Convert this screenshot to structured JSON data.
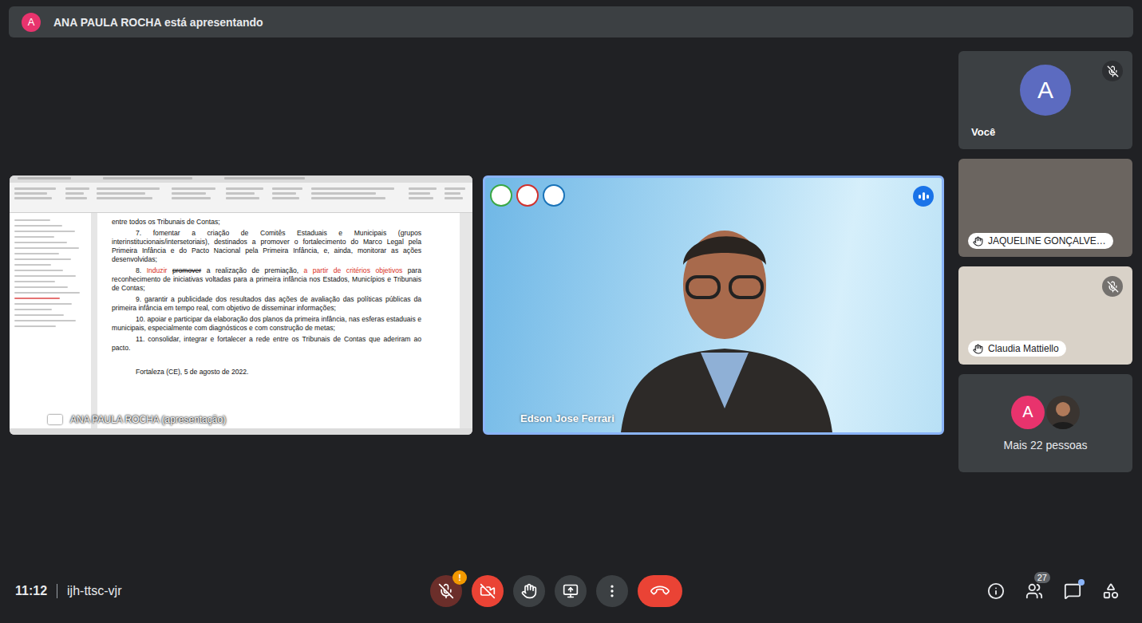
{
  "banner": {
    "avatar": "A",
    "text": "ANA PAULA ROCHA está apresentando"
  },
  "presentation": {
    "label": "ANA PAULA ROCHA (apresentação)",
    "document": {
      "paragraphs": [
        {
          "indent": false,
          "segments": [
            {
              "text": "entre todos os Tribunais de Contas;",
              "style": "normal"
            }
          ]
        },
        {
          "indent": true,
          "segments": [
            {
              "text": "7. fomentar a criação de Comitês Estaduais e Municipais (grupos interinstitucionais/intersetoriais), destinados a promover o fortalecimento do Marco Legal pela Primeira Infância e do Pacto Nacional pela Primeira Infância, e, ainda, monitorar as ações desenvolvidas;",
              "style": "normal"
            }
          ]
        },
        {
          "indent": true,
          "segments": [
            {
              "text": "8. ",
              "style": "normal"
            },
            {
              "text": "Induzir",
              "style": "inserted"
            },
            {
              "text": " ",
              "style": "normal"
            },
            {
              "text": "promover",
              "style": "deleted"
            },
            {
              "text": " a realização de premiação, ",
              "style": "normal"
            },
            {
              "text": "a partir de critérios objetivos",
              "style": "inserted"
            },
            {
              "text": " para reconhecimento de iniciativas voltadas para a primeira infância nos Estados, Municípios e Tribunais de Contas;",
              "style": "normal"
            }
          ]
        },
        {
          "indent": true,
          "segments": [
            {
              "text": "9. garantir a publicidade dos resultados das ações de avaliação das políticas públicas da primeira infância em tempo real, com objetivo de disseminar informações;",
              "style": "normal"
            }
          ]
        },
        {
          "indent": true,
          "segments": [
            {
              "text": "10. apoiar e participar da elaboração dos planos da primeira infância, nas esferas estaduais e municipais, especialmente com diagnósticos e com construção de metas;",
              "style": "normal"
            }
          ]
        },
        {
          "indent": true,
          "segments": [
            {
              "text": "11. consolidar, integrar e fortalecer a rede entre os Tribunais de Contas que aderiram ao pacto.",
              "style": "normal"
            }
          ]
        }
      ],
      "date": "Fortaleza (CE), 5 de agosto de 2022."
    }
  },
  "speaker": {
    "name": "Edson Jose Ferrari",
    "speaking": true
  },
  "participants": [
    {
      "kind": "avatar",
      "name": "Você",
      "avatar": "A",
      "muted": true,
      "hand": false,
      "color": "#5c6bc0"
    },
    {
      "kind": "video",
      "name": "JAQUELINE GONÇALVE…",
      "muted": false,
      "hand": true,
      "color": "#6b6560"
    },
    {
      "kind": "video",
      "name": "Claudia Mattiello",
      "muted": true,
      "hand": true,
      "color": "#d9d2c8"
    }
  ],
  "more": {
    "label": "Mais 22 pessoas",
    "avatars": [
      {
        "kind": "letter",
        "text": "A",
        "color": "#e8336d"
      },
      {
        "kind": "photo",
        "color": "#3a3430"
      }
    ]
  },
  "footer": {
    "time": "11:12",
    "code": "ijh-ttsc-vjr"
  },
  "controls": [
    {
      "kind": "microphone",
      "on": false,
      "alert": "!"
    },
    {
      "kind": "camera",
      "on": false
    },
    {
      "kind": "hand"
    },
    {
      "kind": "present"
    },
    {
      "kind": "more"
    },
    {
      "kind": "leave"
    }
  ],
  "side_controls": [
    {
      "kind": "info"
    },
    {
      "kind": "people",
      "badge": "27"
    },
    {
      "kind": "chat",
      "unread": true
    },
    {
      "kind": "activities"
    }
  ]
}
